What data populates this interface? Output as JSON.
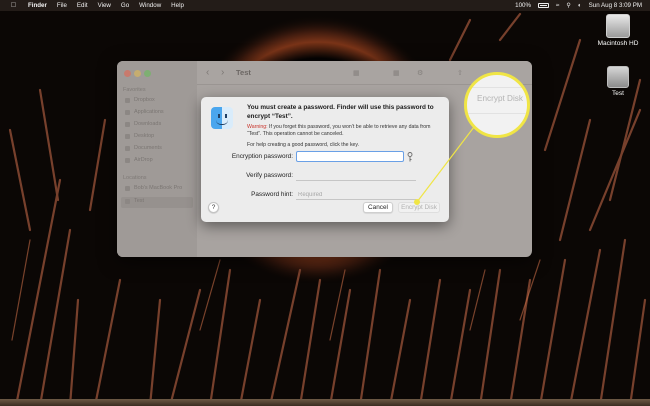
{
  "menubar": {
    "apple_icon": "apple-logo-icon",
    "app_name": "Finder",
    "items": [
      "File",
      "Edit",
      "View",
      "Go",
      "Window",
      "Help"
    ],
    "battery_percent": "100%",
    "datetime": "Sun Aug 8  3:09 PM"
  },
  "desktop": {
    "macintosh_hd_label": "Macintosh HD",
    "test_label": "Test"
  },
  "finder": {
    "window_title": "Test",
    "favorites_heading": "Favorites",
    "favorites": [
      "Dropbox",
      "Applications",
      "Downloads",
      "Desktop",
      "Documents",
      "AirDrop"
    ],
    "locations_heading": "Locations",
    "locations": [
      "Bob's MacBook Pro",
      "Test"
    ]
  },
  "dialog": {
    "title": "You must create a password. Finder will use this password to encrypt “Test”.",
    "warning_label": "Warning:",
    "warning_text": " If you forget this password, you won’t be able to retrieve any data from “Test”. This operation cannot be canceled.",
    "help_text": "For help creating a good password, click the key.",
    "encryption_label": "Encryption password:",
    "encryption_value": "",
    "verify_label": "Verify password:",
    "verify_value": "",
    "hint_label": "Password hint:",
    "hint_placeholder": "Required",
    "help_button": "?",
    "cancel_button": "Cancel",
    "encrypt_button": "Encrypt Disk"
  },
  "callout": {
    "text": "Encrypt Disk",
    "highlight_color": "#f0e545"
  }
}
